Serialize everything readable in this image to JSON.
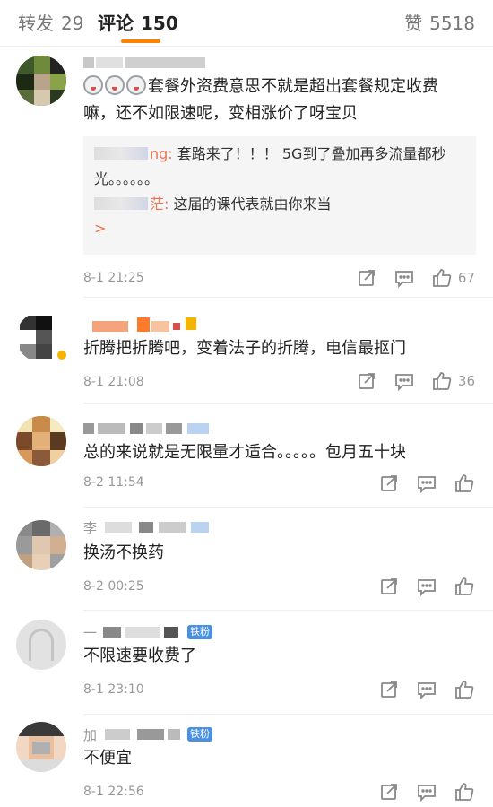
{
  "tabs": {
    "repost": {
      "label": "转发",
      "count": "29"
    },
    "comment": {
      "label": "评论",
      "count": "150"
    },
    "like": {
      "label": "赞",
      "count": "5518"
    }
  },
  "accent_color": "#ff8200",
  "comments": [
    {
      "username": "...ng",
      "text": "套餐外资费意思不就是超出套餐规定收费嘛，还不如限速呢，变相涨价了呀宝贝",
      "replies": [
        {
          "name": "ng:",
          "text": " 套路来了！！！ 5G到了叠加再多流量都秒光。。。。。。"
        },
        {
          "name": "茫:",
          "text": " 这届的课代表就由你来当"
        }
      ],
      "more_label": ">",
      "time": "8-1 21:25",
      "likes": "67"
    },
    {
      "text": "折腾把折腾吧，变着法子的折腾，电信最抠门",
      "time": "8-1 21:08",
      "likes": "36"
    },
    {
      "text": "总的来说就是无限量才适合。。。。。包月五十块",
      "time": "8-2 11:54",
      "likes": ""
    },
    {
      "username": "李",
      "text": "换汤不换药",
      "time": "8-2 00:25",
      "likes": ""
    },
    {
      "username": "一",
      "badge": "铁粉",
      "text": "不限速要收费了",
      "time": "8-1 23:10",
      "likes": ""
    },
    {
      "username": "加",
      "badge": "铁粉",
      "text": "不便宜",
      "time": "8-1 22:56",
      "likes": ""
    }
  ]
}
